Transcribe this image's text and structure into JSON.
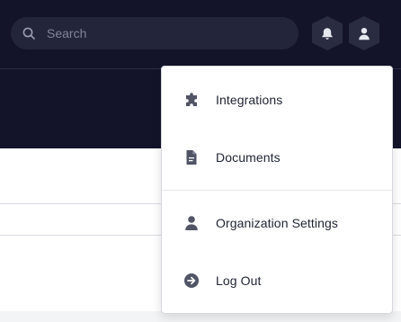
{
  "header": {
    "search": {
      "placeholder": "Search",
      "value": ""
    },
    "icons": {
      "search": "search-icon",
      "notifications": "bell-icon",
      "account": "user-icon"
    }
  },
  "account_menu": {
    "items": [
      {
        "label": "Integrations",
        "icon": "puzzle-icon"
      },
      {
        "label": "Documents",
        "icon": "document-icon"
      },
      {
        "label": "Organization Settings",
        "icon": "user-icon"
      },
      {
        "label": "Log Out",
        "icon": "arrow-circle-right-icon"
      }
    ]
  },
  "colors": {
    "header_bg": "#13142a",
    "search_bg": "#23253b",
    "icon": "#505465",
    "menu_text": "#1f2333"
  }
}
